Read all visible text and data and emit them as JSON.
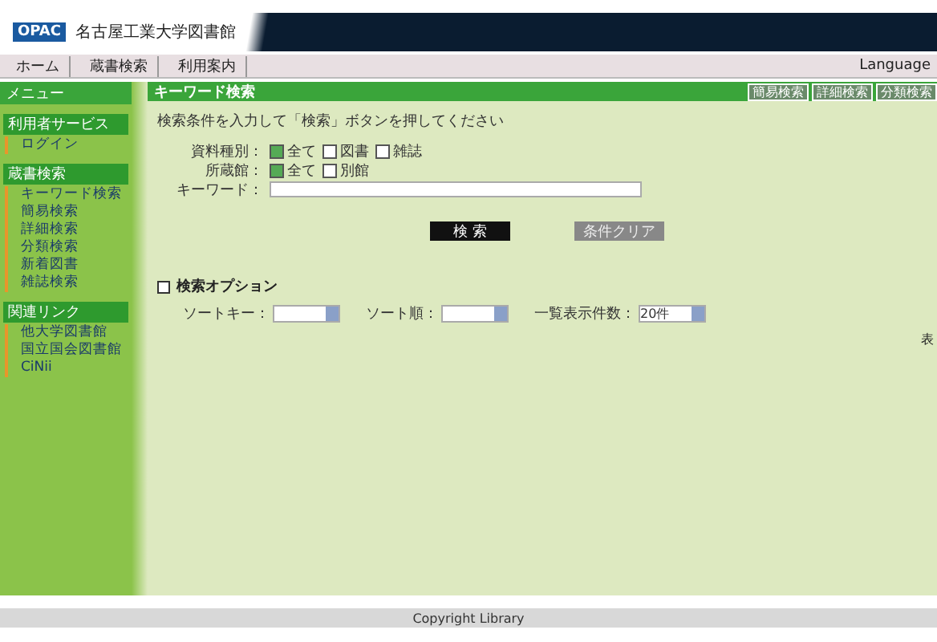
{
  "header": {
    "logo": "OPAC",
    "title": "名古屋工業大学図書館"
  },
  "nav": {
    "items": [
      {
        "label": "ホーム"
      },
      {
        "label": "蔵書検索"
      },
      {
        "label": "利用案内"
      }
    ],
    "language": "Language"
  },
  "sidebar": {
    "title": "メニュー",
    "sections": [
      {
        "title": "利用者サービス",
        "items": [
          "ログイン"
        ]
      },
      {
        "title": "蔵書検索",
        "items": [
          "キーワード検索",
          "簡易検索",
          "詳細検索",
          "分類検索",
          "新着図書",
          "雑誌検索"
        ]
      },
      {
        "title": "関連リンク",
        "items": [
          "他大学図書館",
          "国立国会図書館",
          "CiNii"
        ]
      }
    ]
  },
  "main": {
    "title": "キーワード検索",
    "tabs": [
      {
        "label": "簡易検索",
        "selected": false
      },
      {
        "label": "詳細検索",
        "selected": false
      },
      {
        "label": "分類検索",
        "selected": false
      }
    ],
    "instruction": "検索条件を入力して「検索」ボタンを押してください",
    "filters": [
      {
        "label": "資料種別：",
        "options": [
          {
            "label": "全て",
            "checked": true
          },
          {
            "label": "図書",
            "checked": false
          },
          {
            "label": "雑誌",
            "checked": false
          }
        ]
      },
      {
        "label": "所蔵館：",
        "options": [
          {
            "label": "全て",
            "checked": true
          },
          {
            "label": "別館",
            "checked": false
          }
        ]
      }
    ],
    "keyword_label": "キーワード：",
    "search_button": "検 索",
    "clear_button": "条件クリア",
    "options": {
      "label": "検索オプション",
      "expanded": false,
      "selects": [
        {
          "label": "ソートキー："
        },
        {
          "label": "ソート順："
        },
        {
          "label": "一覧表示件数：",
          "value": "20件"
        }
      ]
    },
    "side_note": "表"
  },
  "footer": "Copyright Library"
}
